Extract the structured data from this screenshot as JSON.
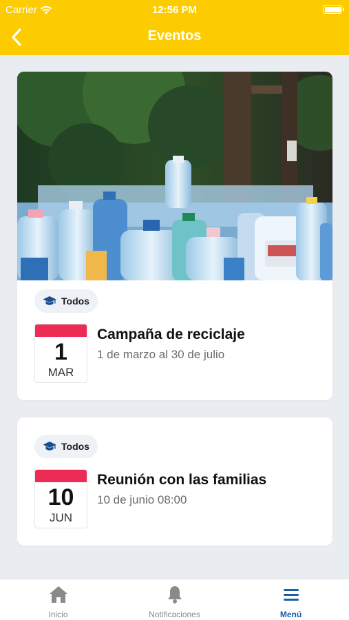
{
  "status_bar": {
    "carrier": "Carrier",
    "time": "12:56 PM"
  },
  "header": {
    "title": "Eventos"
  },
  "events": [
    {
      "tag": "Todos",
      "day": "1",
      "month": "MAR",
      "title": "Campaña de reciclaje",
      "subtitle": "1 de marzo al 30 de julio",
      "has_image": true
    },
    {
      "tag": "Todos",
      "day": "10",
      "month": "JUN",
      "title": "Reunión con las familias",
      "subtitle": "10 de junio 08:00",
      "has_image": false
    }
  ],
  "tabbar": {
    "items": [
      {
        "label": "Inicio",
        "icon": "home-icon",
        "active": false
      },
      {
        "label": "Notificaciones",
        "icon": "bell-icon",
        "active": false
      },
      {
        "label": "Menú",
        "icon": "menu-icon",
        "active": true
      }
    ]
  },
  "colors": {
    "header_bg": "#fdcc00",
    "date_accent": "#ec2c55",
    "tag_icon": "#1a4f8f",
    "active_tab": "#1a5fa8",
    "background": "#e9ecf0"
  }
}
